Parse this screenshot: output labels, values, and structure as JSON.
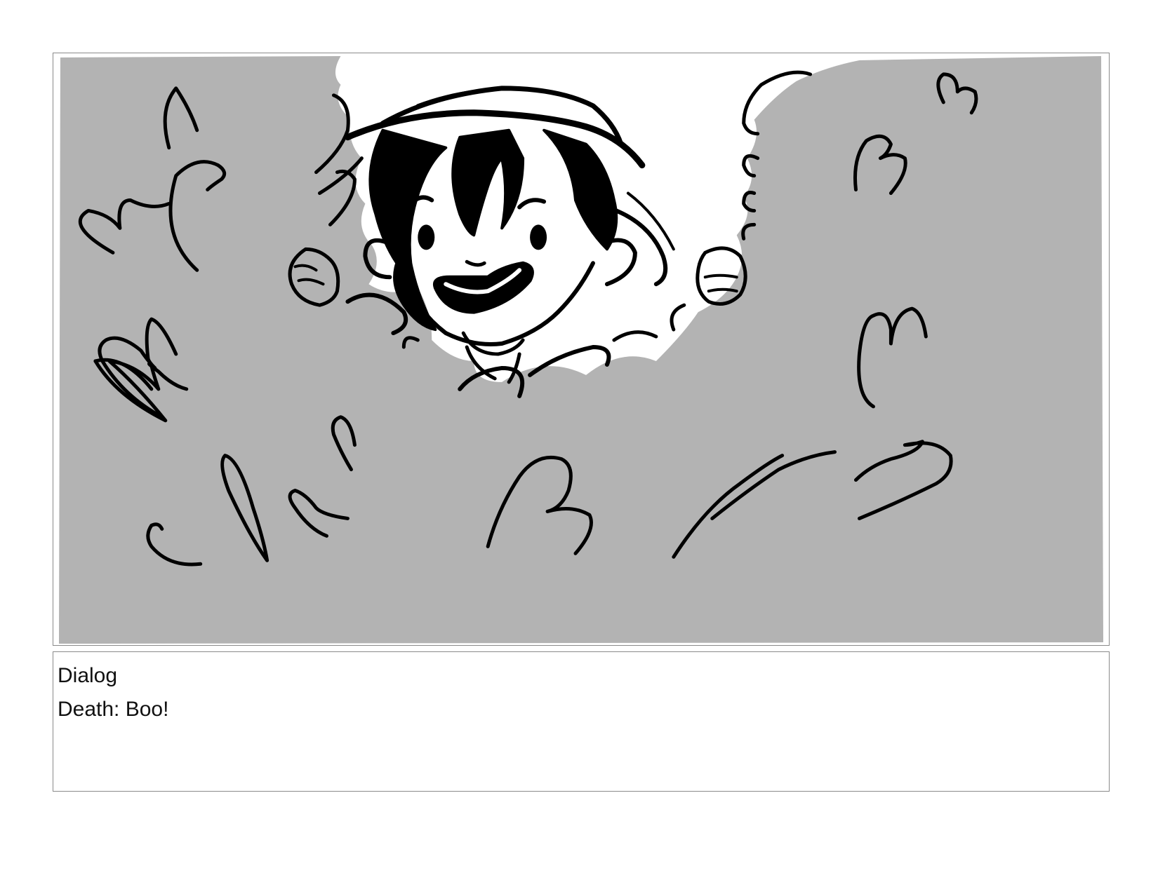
{
  "panel": {
    "icon": "storyboard-sketch",
    "colors": {
      "smoke": "#b3b3b3",
      "ink": "#000000",
      "paper": "#ffffff"
    }
  },
  "notes": {
    "heading": "Dialog",
    "line": "Death: Boo!"
  }
}
